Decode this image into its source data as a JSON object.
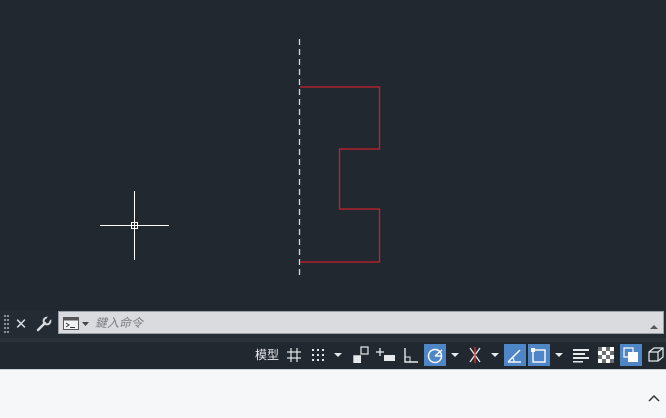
{
  "command": {
    "placeholder": "鍵入命令",
    "value": "",
    "icons": [
      "grip-handle-icon",
      "close-icon",
      "wrench-icon",
      "command-prompt-icon",
      "chevron-down-icon",
      "chevron-up-icon"
    ]
  },
  "status": {
    "model_label": "模型",
    "buttons": [
      {
        "name": "grid-display",
        "icon": "grid-icon",
        "active": false
      },
      {
        "name": "snap-mode",
        "icon": "snap-grid-icon",
        "active": false
      },
      {
        "name": "snap-menu",
        "icon": "chevron-down-icon",
        "active": false
      },
      {
        "name": "infer-constraints",
        "icon": "infer-icon",
        "active": false
      },
      {
        "name": "dynamic-input",
        "icon": "dynamic-input-icon",
        "active": false
      },
      {
        "name": "ortho-mode",
        "icon": "ortho-icon",
        "active": false
      },
      {
        "name": "polar-tracking",
        "icon": "polar-icon",
        "active": true
      },
      {
        "name": "polar-menu",
        "icon": "chevron-down-icon",
        "active": false
      },
      {
        "name": "isometric-drafting",
        "icon": "isodraft-icon",
        "active": false
      },
      {
        "name": "isodraft-menu",
        "icon": "chevron-down-icon",
        "active": false
      },
      {
        "name": "object-snap-tracking",
        "icon": "snap-tracking-icon",
        "active": true
      },
      {
        "name": "object-snap",
        "icon": "osnap-icon",
        "active": true
      },
      {
        "name": "osnap-menu",
        "icon": "chevron-down-icon",
        "active": false
      },
      {
        "name": "lineweight",
        "icon": "lineweight-icon",
        "active": false
      },
      {
        "name": "transparency",
        "icon": "transparency-icon",
        "active": false
      },
      {
        "name": "selection-cycling",
        "icon": "selection-cycling-icon",
        "active": true
      },
      {
        "name": "3d-object-snap",
        "icon": "3d-osnap-icon",
        "active": false
      }
    ]
  },
  "colors": {
    "canvas_bg": "#212830",
    "profile_line": "#c8202a",
    "centerline": "#d8d8d8",
    "crosshair": "#ffffff",
    "active_toggle": "#4f86c6"
  },
  "bottom_panel": {
    "collapse_icon": "chevron-up-icon"
  }
}
